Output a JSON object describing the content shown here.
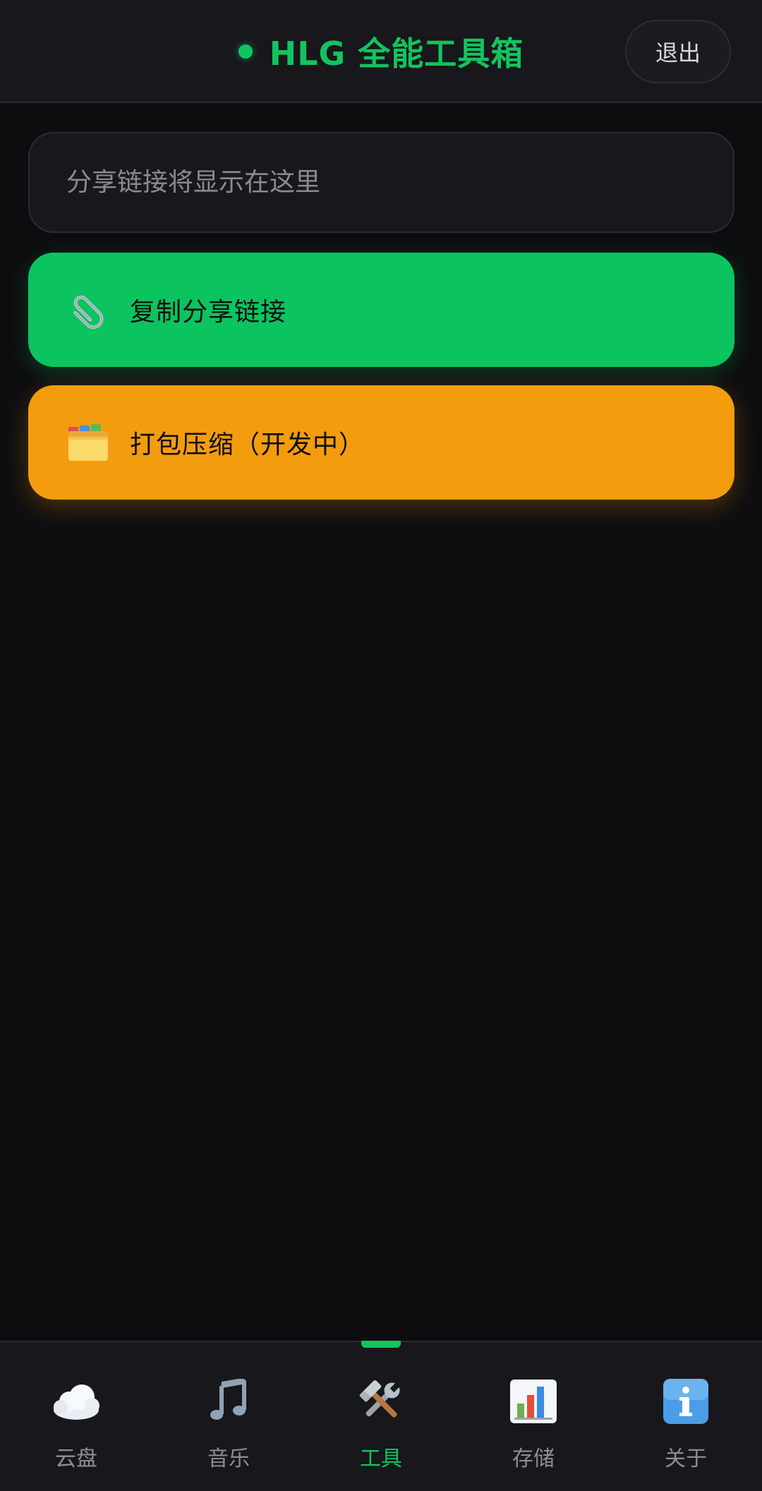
{
  "header": {
    "title": "HLG 全能工具箱",
    "logout_label": "退出"
  },
  "share": {
    "placeholder": "分享链接将显示在这里",
    "value": ""
  },
  "actions": {
    "copy_label": "复制分享链接",
    "copy_icon": "paperclip-icon",
    "pack_label": "打包压缩（开发中）",
    "pack_icon": "folder-icon"
  },
  "nav": {
    "active": "tools",
    "items": [
      {
        "id": "cloud",
        "label": "云盘",
        "icon": "cloud-icon"
      },
      {
        "id": "music",
        "label": "音乐",
        "icon": "music-note-icon"
      },
      {
        "id": "tools",
        "label": "工具",
        "icon": "tools-icon"
      },
      {
        "id": "storage",
        "label": "存储",
        "icon": "bar-chart-icon"
      },
      {
        "id": "about",
        "label": "关于",
        "icon": "info-icon"
      }
    ]
  },
  "colors": {
    "accent": "#12c45f",
    "copy_button": "#0bc45f",
    "pack_button": "#f39c0d",
    "background": "#0d0d10",
    "surface": "#17171c"
  }
}
